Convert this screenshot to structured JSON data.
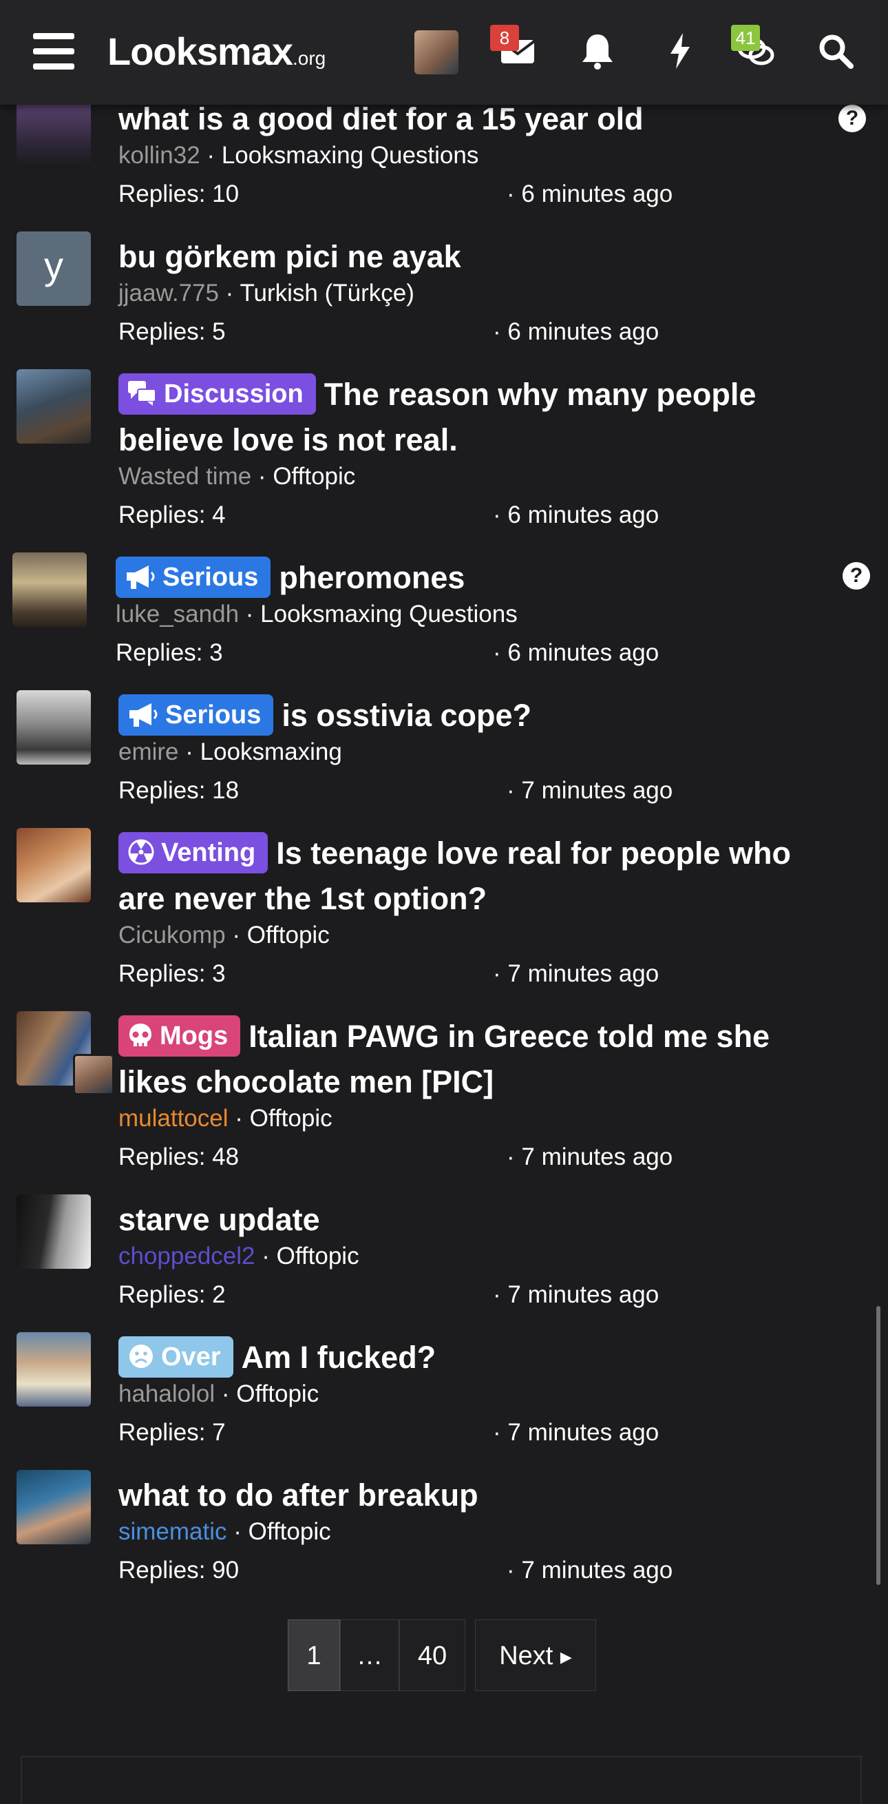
{
  "header": {
    "logo_main": "Looksmax",
    "logo_suffix": ".org",
    "inbox_badge": "8",
    "alerts_badge": "41",
    "badge_colors": {
      "inbox": "#d9413a",
      "alerts": "#8cc63f"
    }
  },
  "threads": [
    {
      "title": "what is a good diet for a 15 year old",
      "user": "kollin32",
      "forum": "Looksmaxing Questions",
      "replies": "Replies: 10",
      "time": "· 6 minutes ago",
      "label": null,
      "help": true
    },
    {
      "title": "bu görkem pici ne ayak",
      "user": "jjaaw.775",
      "forum": "Turkish (Türkçe)",
      "replies": "Replies: 5",
      "time": "· 6 minutes ago",
      "label": null,
      "avatar_letter": "y"
    },
    {
      "title": "The reason why many people believe love is not real.",
      "user": "Wasted time",
      "forum": "Offtopic",
      "replies": "Replies: 4",
      "time": "· 6 minutes ago",
      "label": "Discussion",
      "label_color": "#7b4fe0",
      "label_icon": "speech-bubbles-icon"
    },
    {
      "title": "pheromones",
      "user": "luke_sandh",
      "forum": "Looksmaxing Questions",
      "replies": "Replies: 3",
      "time": "· 6 minutes ago",
      "label": "Serious",
      "label_color": "#2b78e4",
      "label_icon": "megaphone-icon",
      "help": true
    },
    {
      "title": "is osstivia cope?",
      "user": "emire",
      "forum": "Looksmaxing",
      "replies": "Replies: 18",
      "time": "· 7 minutes ago",
      "label": "Serious",
      "label_color": "#2b78e4",
      "label_icon": "megaphone-icon"
    },
    {
      "title": "Is teenage love real for people who are never the 1st option?",
      "user": "Cicukomp",
      "forum": "Offtopic",
      "replies": "Replies: 3",
      "time": "· 7 minutes ago",
      "label": "Venting",
      "label_color": "#7b4fe0",
      "label_icon": "radiation-icon"
    },
    {
      "title": "Italian PAWG in Greece told me she likes chocolate men [PIC]",
      "user": "mulattocel",
      "forum": "Offtopic",
      "replies": "Replies: 48",
      "time": "· 7 minutes ago",
      "label": "Mogs",
      "label_color": "#d9447a",
      "label_icon": "skull-icon",
      "user_color": "#e88a2e"
    },
    {
      "title": "starve update",
      "user": "choppedcel2",
      "forum": "Offtopic",
      "replies": "Replies: 2",
      "time": "· 7 minutes ago",
      "label": null,
      "user_color": "#5a4fcf"
    },
    {
      "title": "Am I fucked?",
      "user": "hahalolol",
      "forum": "Offtopic",
      "replies": "Replies: 7",
      "time": "· 7 minutes ago",
      "label": "Over",
      "label_color": "#8fc7ea",
      "label_icon": "sad-face-icon"
    },
    {
      "title": "what to do after breakup",
      "user": "simematic",
      "forum": "Offtopic",
      "replies": "Replies: 90",
      "time": "· 7 minutes ago",
      "label": null,
      "user_color": "#4a8fe0"
    }
  ],
  "pagination": {
    "current": "1",
    "ellipsis": "…",
    "last": "40",
    "next": "Next"
  }
}
